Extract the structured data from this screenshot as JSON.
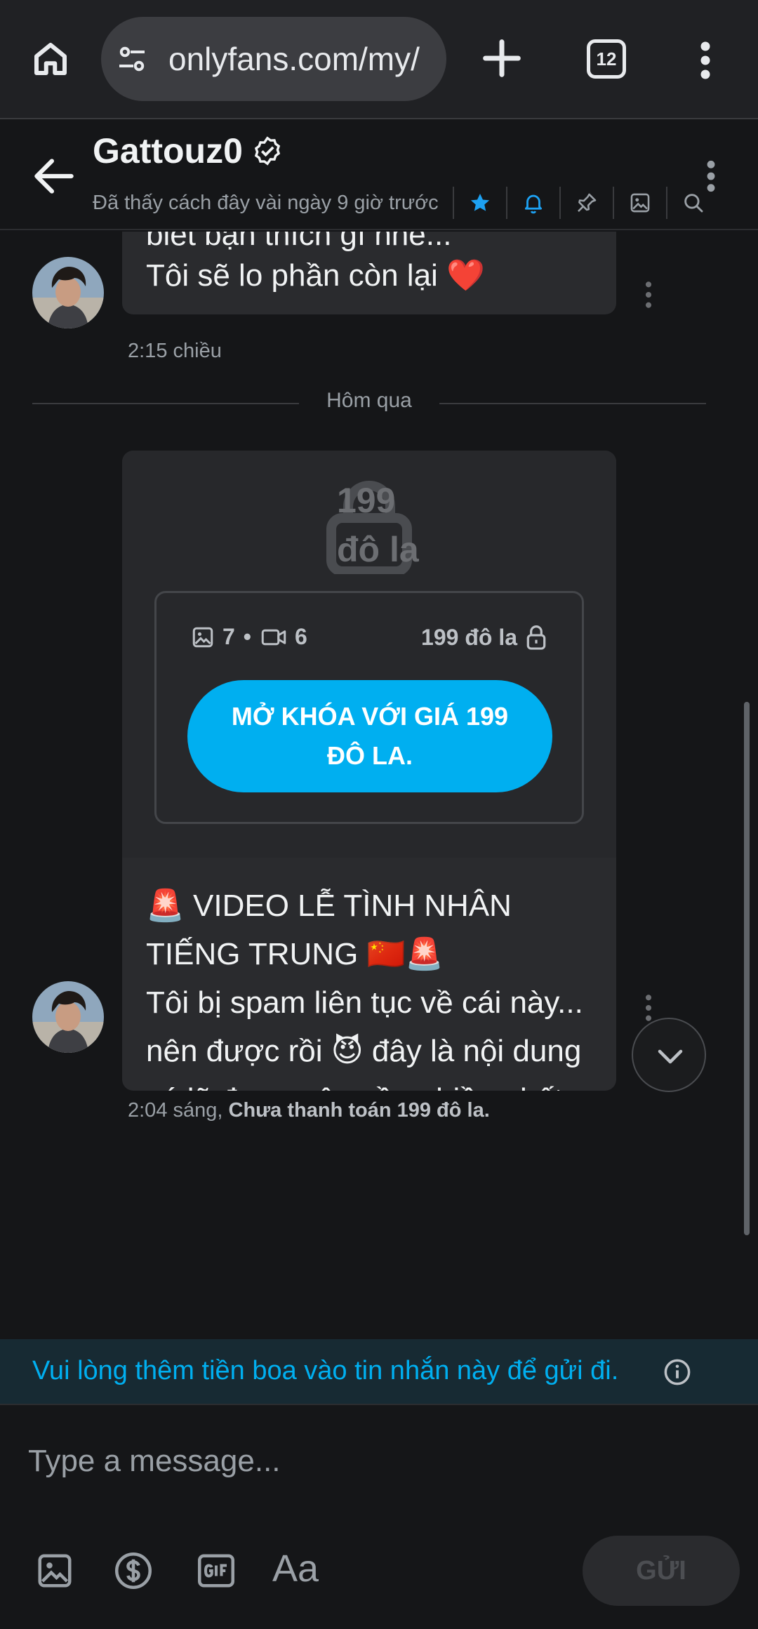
{
  "browser": {
    "url": "onlyfans.com/my/",
    "tab_count": "12",
    "icons": [
      "home-icon",
      "site-settings-icon",
      "new-tab-icon",
      "tab-switcher-icon",
      "browser-menu-icon"
    ]
  },
  "chat_header": {
    "name": "Gattouz0",
    "last_seen": "Đã thấy cách đây vài ngày 9 giờ trước",
    "icons": [
      "back-arrow-icon",
      "verified-icon",
      "star-icon",
      "bell-icon",
      "pin-icon",
      "gallery-icon",
      "search-icon",
      "more-icon"
    ]
  },
  "messages": {
    "first": {
      "line1": "biết bạn thích gì nhé...",
      "line2": "Tôi sẽ lo phần còn lại ❤️",
      "time": "2:15 chiều"
    },
    "day_divider": "Hôm qua",
    "locked": {
      "lock_price": "199 đô la",
      "photo_count": "7",
      "dot": "•",
      "video_count": "6",
      "price": "199 đô la",
      "unlock_label": "MỞ KHÓA VỚI GIÁ 199 ĐÔ LA.",
      "caption": "🚨 VIDEO LỄ TÌNH NHÂN TIẾNG TRUNG 🇨🇳🚨\nTôi bị spam liên tục về cái này... nên được rồi 😈 đây là nội dung có lẽ được yêu cầu nhiều nhất gần đây, hơi điên rồ nhỉ lol, chúc các fan cuồng của tôi vui vẻ 🍒🍑🍆",
      "time": "2:04 sáng,",
      "payment_status": "Chưa thanh toán 199 đô la."
    }
  },
  "tip_notice": "Vui lòng thêm tiền boa vào tin nhắn này để gửi đi.",
  "composer": {
    "placeholder": "Type a message...",
    "font_label": "Aa",
    "send_label": "GỬI"
  },
  "colors": {
    "accent": "#00aff0",
    "background": "#151618",
    "bubble": "#2a2b2e"
  }
}
